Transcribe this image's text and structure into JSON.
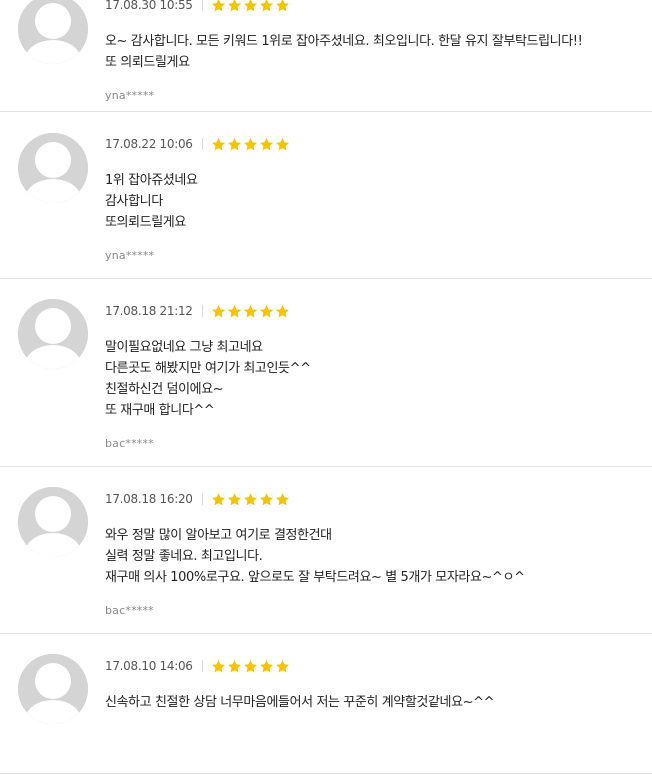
{
  "icons": {
    "avatar": "default-user-avatar-icon",
    "star": "star-icon"
  },
  "colors": {
    "star": "#f5c400",
    "avatar_bg": "#d4d4d4",
    "divider": "#e2e2e2"
  },
  "reviews": [
    {
      "date": "17.08.30 10:55",
      "rating": 5,
      "lines": [
        "오~ 감사합니다. 모든 키워드 1위로 잡아주셨네요. 최오입니다. 한달 유지 잘부탁드립니다!!",
        "또 의뢰드릴게요"
      ],
      "author": "yna*****"
    },
    {
      "date": "17.08.22 10:06",
      "rating": 5,
      "lines": [
        "1위 잡아쥬셨네요",
        "감사합니다",
        "또의뢰드릴게요"
      ],
      "author": "yna*****"
    },
    {
      "date": "17.08.18 21:12",
      "rating": 5,
      "lines": [
        "말이필요없네요 그냥 최고네요",
        "다른곳도 해봤지만 여기가 최고인듯^^",
        "친절하신건 덤이에요~",
        "또 재구매 합니다^^"
      ],
      "author": "bac*****"
    },
    {
      "date": "17.08.18 16:20",
      "rating": 5,
      "lines": [
        "와우 정말 많이 알아보고 여기로 결정한건대",
        "실력 정말 좋네요. 최고입니다.",
        "재구매 의사 100%로구요. 앞으로도 잘 부탁드려요~ 별 5개가 모자라요~^ㅇ^"
      ],
      "author": "bac*****"
    },
    {
      "date": "17.08.10 14:06",
      "rating": 5,
      "lines": [
        "신속하고 친절한 상담 너무마음에들어서 저는 꾸준히 계약할것같네요~^^"
      ],
      "author": ""
    }
  ]
}
